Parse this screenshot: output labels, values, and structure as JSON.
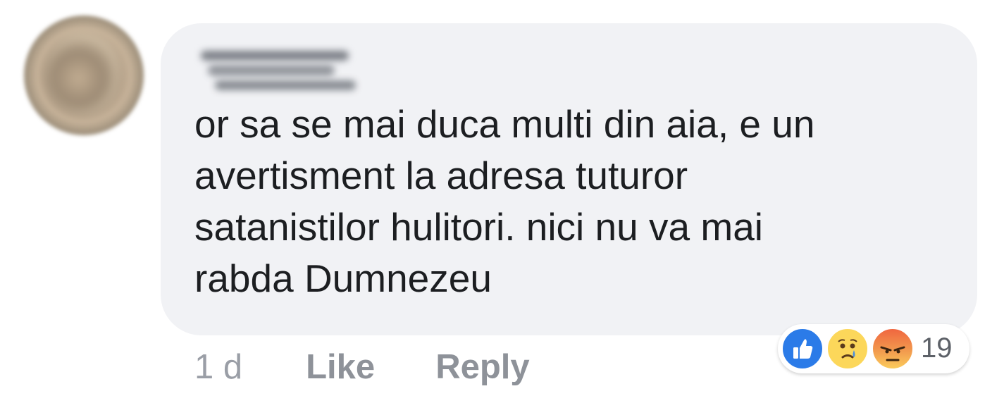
{
  "comment": {
    "text": "or sa se mai duca multi din aia, e un\navertisment la adresa tuturor\nsatanistilor hulitori. nici nu va mai\nrabda Dumnezeu"
  },
  "actions": {
    "time": "1 d",
    "like_label": "Like",
    "reply_label": "Reply"
  },
  "reactions": {
    "types": [
      "like-icon",
      "sad-icon",
      "angry-icon"
    ],
    "count": "19"
  },
  "colors": {
    "bubble": "#f1f2f5",
    "text": "#1c1e21",
    "action": "#8e9299",
    "like_blue": "#2b7be8"
  }
}
